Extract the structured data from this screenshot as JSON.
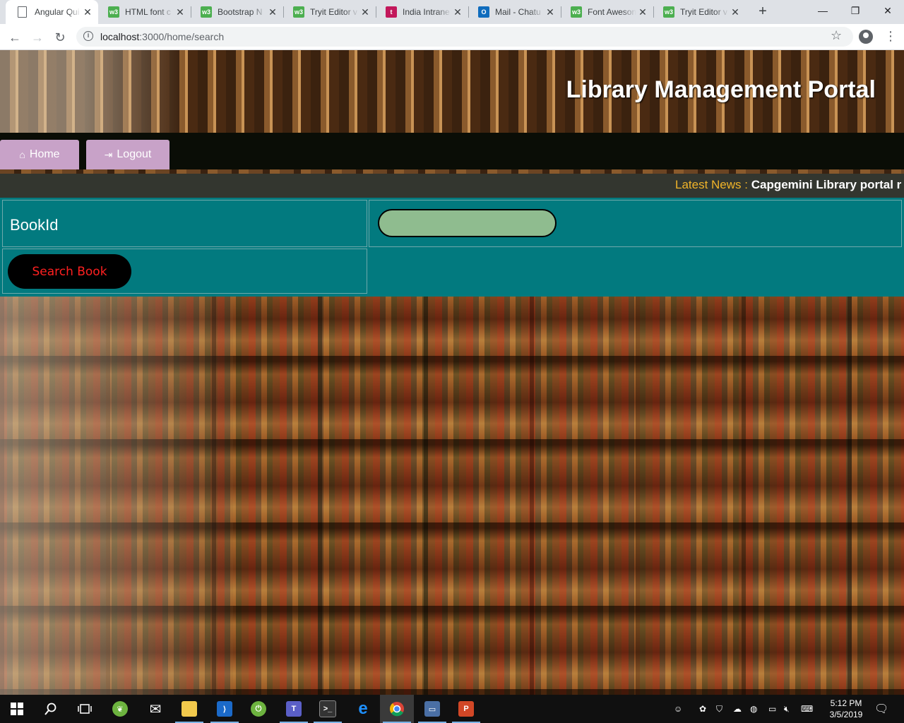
{
  "browser": {
    "tabs": [
      {
        "title": "Angular Qui",
        "icon": "document-icon",
        "active": true
      },
      {
        "title": "HTML font c",
        "icon": "w3schools-icon"
      },
      {
        "title": "Bootstrap N",
        "icon": "w3schools-icon"
      },
      {
        "title": "Tryit Editor v",
        "icon": "w3schools-icon"
      },
      {
        "title": "India Intrane",
        "icon": "t-icon"
      },
      {
        "title": "Mail - Chatu",
        "icon": "outlook-icon"
      },
      {
        "title": "Font Aweson",
        "icon": "w3schools-icon"
      },
      {
        "title": "Tryit Editor v",
        "icon": "w3schools-icon"
      }
    ],
    "url_host": "localhost",
    "url_path": ":3000/home/search"
  },
  "page": {
    "title": "Library Management Portal",
    "nav": {
      "home_label": "Home",
      "logout_label": "Logout"
    },
    "news": {
      "label": "Latest News : ",
      "text": "Capgemini Library portal r"
    },
    "form": {
      "bookid_label": "BookId",
      "bookid_value": "",
      "search_button": "Search Book"
    }
  },
  "taskbar": {
    "time": "5:12 PM",
    "date": "3/5/2019"
  }
}
